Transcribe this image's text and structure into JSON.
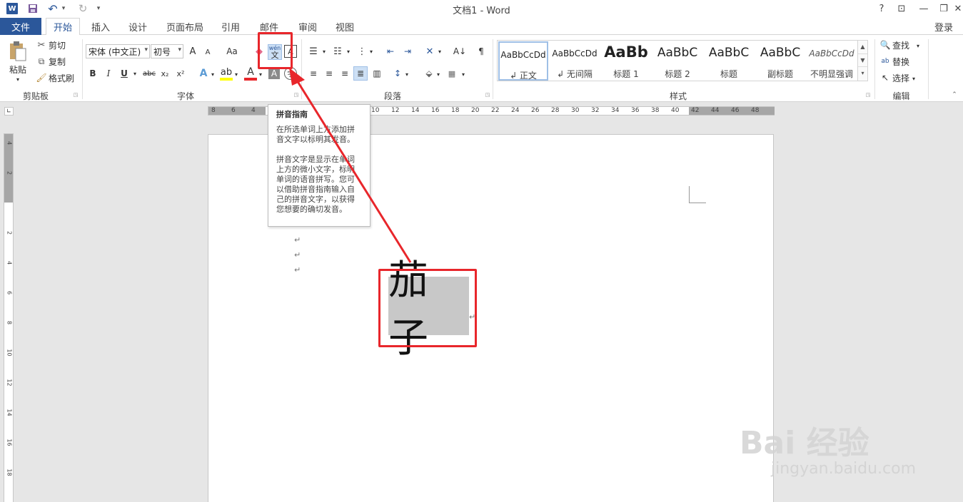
{
  "window": {
    "title": "文档1 - Word",
    "help": "?",
    "restore_ribbon": "⊡",
    "minimize": "—",
    "maximize": "❐",
    "close": "✕"
  },
  "quick_access": {
    "logo": "W",
    "save": "💾",
    "undo": "↶",
    "undo_dd": "▾",
    "redo": "↻",
    "customize": "▾"
  },
  "tabs": [
    {
      "label": "文件"
    },
    {
      "label": "开始"
    },
    {
      "label": "插入"
    },
    {
      "label": "设计"
    },
    {
      "label": "页面布局"
    },
    {
      "label": "引用"
    },
    {
      "label": "邮件"
    },
    {
      "label": "审阅"
    },
    {
      "label": "视图"
    }
  ],
  "login": "登录",
  "clipboard": {
    "paste": "粘贴",
    "cut": "剪切",
    "copy": "复制",
    "format_painter": "格式刷",
    "group_label": "剪贴板"
  },
  "font": {
    "font_name": "宋体 (中文正)",
    "font_size": "初号",
    "grow": "A",
    "shrink": "A",
    "change_case": "Aa",
    "bold": "B",
    "italic": "I",
    "underline": "U",
    "strikethrough": "abc",
    "subscript": "x₂",
    "superscript": "x²",
    "pinyin_top": "wén",
    "pinyin_char": "文",
    "char_border": "A",
    "group_label": "字体"
  },
  "paragraph": {
    "group_label": "段落"
  },
  "styles": {
    "group_label": "样式",
    "items": [
      {
        "sample": "AaBbCcDd",
        "name": "↲ 正文"
      },
      {
        "sample": "AaBbCcDd",
        "name": "↲ 无间隔"
      },
      {
        "sample": "AaBb",
        "name": "标题 1"
      },
      {
        "sample": "AaBbC",
        "name": "标题 2"
      },
      {
        "sample": "AaBbC",
        "name": "标题"
      },
      {
        "sample": "AaBbC",
        "name": "副标题"
      },
      {
        "sample": "AaBbCcDd",
        "name": "不明显强调"
      }
    ]
  },
  "editing": {
    "find": "查找",
    "replace": "替换",
    "select": "选择",
    "group_label": "编辑"
  },
  "ruler": {
    "h_ticks": [
      "8",
      "6",
      "4",
      "",
      "",
      "",
      "",
      "",
      "10",
      "12",
      "14",
      "16",
      "18",
      "20",
      "22",
      "24",
      "26",
      "28",
      "30",
      "32",
      "34",
      "36",
      "38",
      "40",
      "42",
      "44",
      "46",
      "48"
    ],
    "v_ticks": [
      "4",
      "2",
      "",
      "2",
      "4",
      "6",
      "8",
      "10",
      "12",
      "14",
      "16",
      "18"
    ]
  },
  "tooltip": {
    "title": "拼音指南",
    "line1": "在所选单词上方添加拼音文字以标明其发音。",
    "line2": "拼音文字是显示在单词上方的微小文字，标明单词的语音拼写。您可以借助拼音指南输入自己的拼音文字，以获得您想要的确切发音。"
  },
  "document": {
    "text": "茄子",
    "para_mark": "↵"
  },
  "watermark": {
    "brand": "Bai 经验",
    "url": "jingyan.baidu.com"
  },
  "colors": {
    "accent": "#2b579a",
    "highlight_red": "#e8262b"
  }
}
